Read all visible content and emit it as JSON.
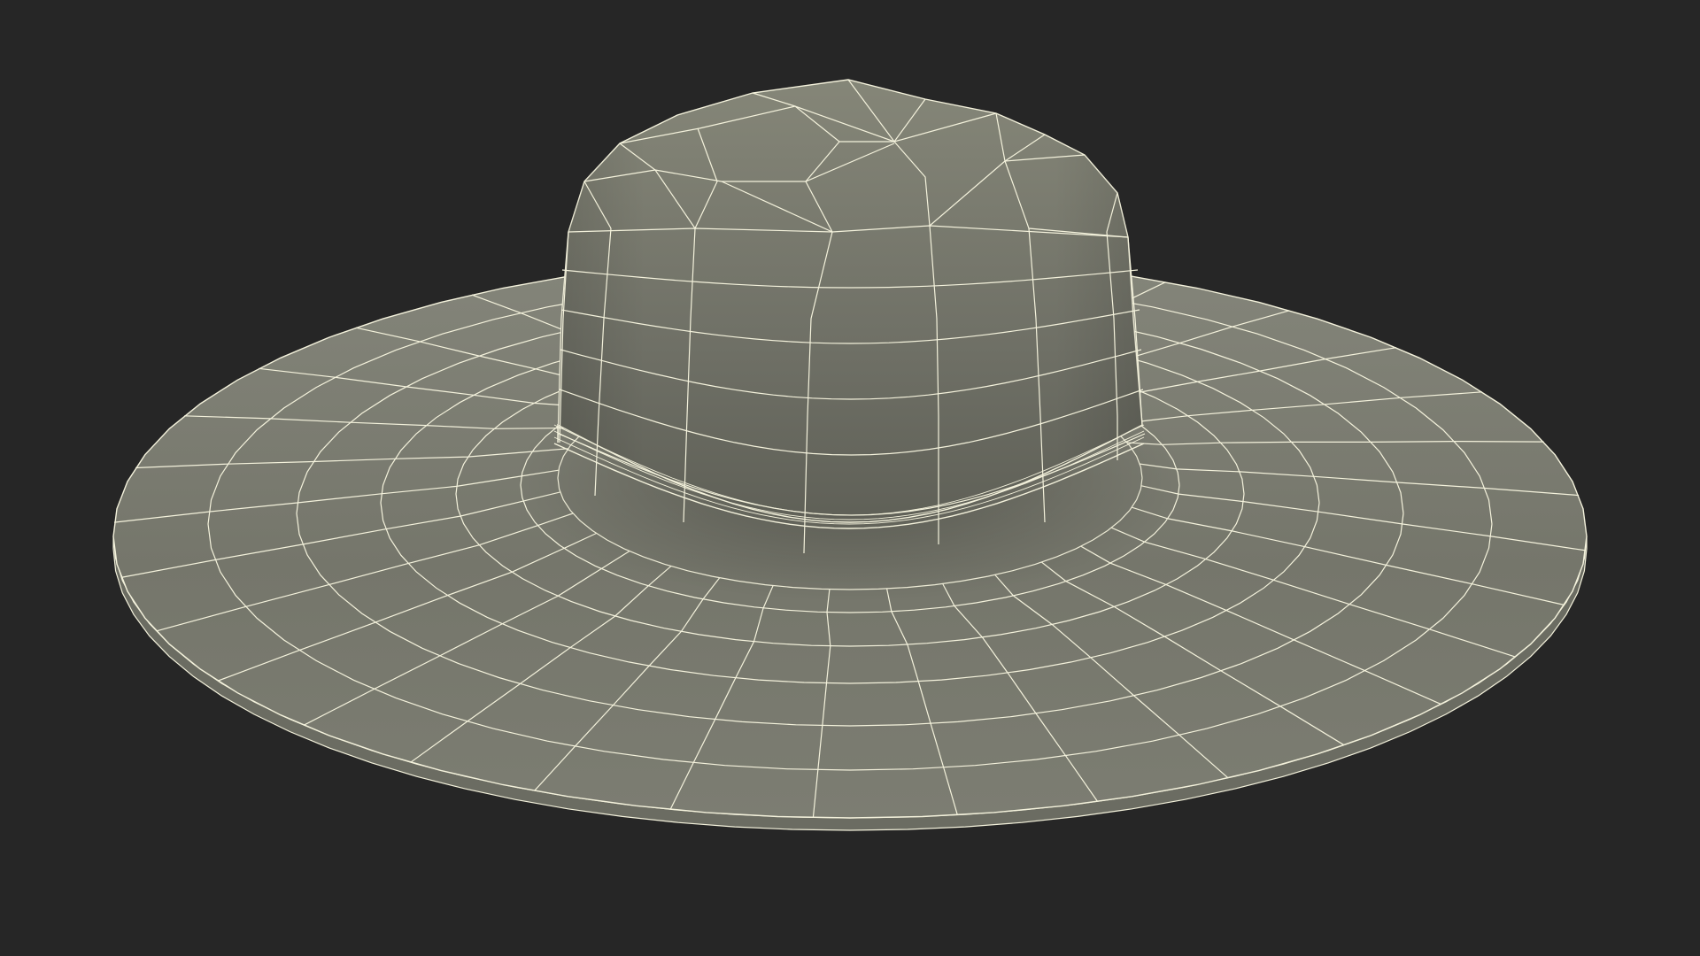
{
  "scene": {
    "subject_icon": "wireframe-wide-brim-hat-icon",
    "render_mode": "wireframe-over-shaded",
    "colors": {
      "background": "#262626",
      "surface_light": "#84857a",
      "surface_mid": "#75766b",
      "surface_dark": "#5f6057",
      "wire": "#f4f2dc",
      "rim_side": "#6b6c62"
    }
  }
}
